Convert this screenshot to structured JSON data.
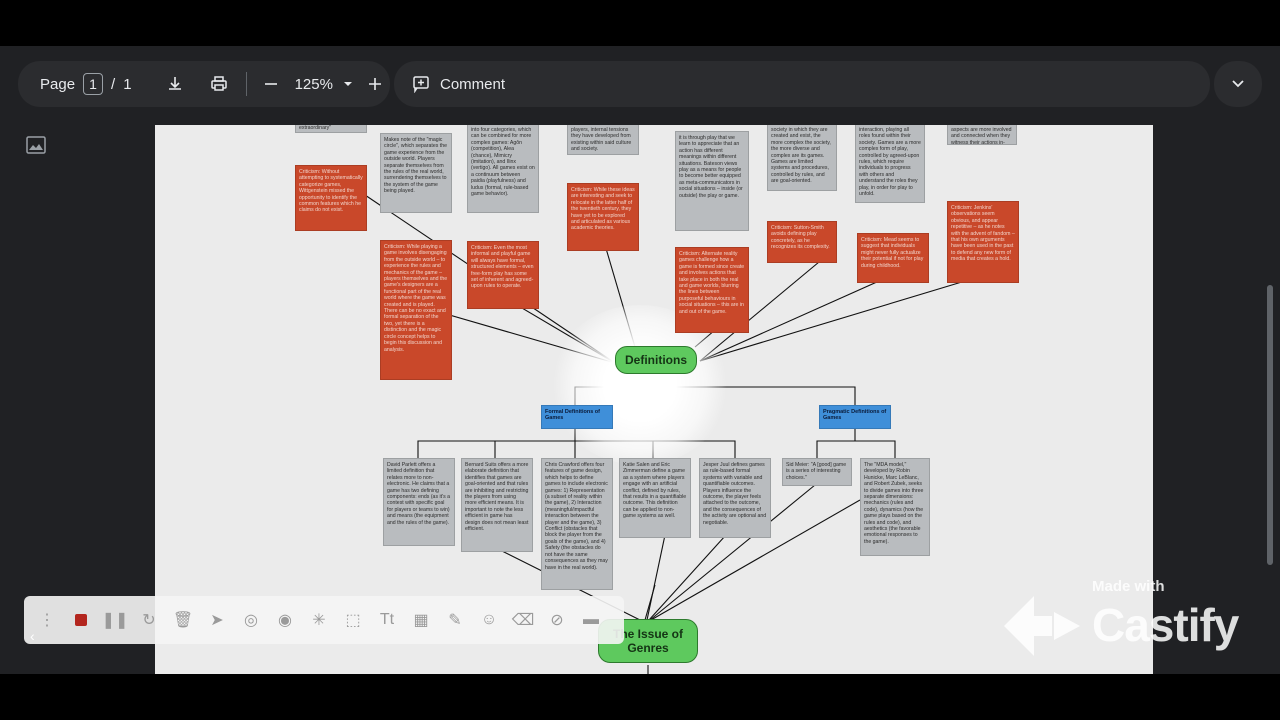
{
  "toolbar": {
    "page_label": "Page",
    "page_current": "1",
    "page_separator": "/",
    "page_total": "1",
    "zoom": "125%",
    "comment_label": "Comment"
  },
  "diagram": {
    "center": "Definitions",
    "genres": "The Issue of Genres",
    "formal": "Formal Definitions of Games",
    "pragmatic": "Pragmatic Definitions of Games",
    "top_gray": [
      "extraordinary\"",
      "Makes note of the \"magic circle\", which separates the game experience from the outside world. Players separate themselves from the rules of the real world, surrendering themselves to the system of the game being played.",
      "into four categories, which can be combined for more complex games: Agôn (competition), Alea (chance), Mimicry (imitation), and Ilinx (vertigo). All games exist on a continuum between paidia (playfulness) and ludus (formal, rule-based game behavior).",
      "players, internal tensions they have developed from existing within said culture and society.",
      "it is through play that we learn to appreciate that an action has different meanings within different situations. Bateson views play as a means for people to become better equipped as meta-communicators in social situations – inside (or outside) the play or game.",
      "society in which they are created and exist, the more complex the society, the more diverse and complex are its games. Games are limited systems and procedures, controlled by rules, and are goal-oriented.",
      "interaction, playing all roles found within their society. Games are a more complex form of play, controlled by agreed-upon rules, which require individuals to progress with others and understand the roles they play, in order for play to unfold.",
      "aspects are more involved and connected when they witness their actions in-game having significant impact, resulting in in-game success"
    ],
    "top_red": [
      "Criticism: Without attempting to systematically categorize games, Wittgenstein missed the opportunity to identify the common features which he claims do not exist.",
      "Criticism: While playing a game involves disengaging from the outside world – to experience the rules and mechanics of the game – players themselves and the game's designers are a functional part of the real world where the game was created and is played. There can be no exact and formal separation of the two, yet there is a distinction and the magic circle concept helps to begin this discussion and analysis.",
      "Criticism: Even the most informal and playful game will always have formal, structured elements – even free-form play has some set of inherent and agreed-upon rules to operate.",
      "Criticism: While these ideas are interesting and seek to relocate in the latter half of the twentieth century, they have yet to be explored and articulated as various academic theories.",
      "Criticism: Alternate reality games challenge how a game is formed since create and involves actions that take place in both the real and game worlds, blurring the lines between purposeful behaviours in social situations – this are in and out of the game.",
      "Criticism: Sutton-Smith avoids defining play concretely, as he recognizes its complexity.",
      "Criticism: Mead seems to suggest that individuals might never fully actualize their potential if not for play during childhood.",
      "Criticism: Jenkins' observations seem obvious, and appear repetitive – as he notes with the advent of fandom – that his own arguments have been used in the past to defend any new form of media that creates a hold."
    ],
    "bottom_gray": [
      "David Parlett offers a limited definition that relates more to non-electronic. He claims that a game has two defining components: ends (as it's a contest with specific goal for players or teams to win) and means (the equipment and the rules of the game).",
      "Bernard Suits offers a more elaborate definition that identifies that games are goal-oriented and that rules are inhibiting and restricting the players from using more efficient means. It is important to note the less efficient in game has design does not mean least efficient.",
      "Chris Crawford offers four features of game design, which helps to define games to include electronic games: 1) Representation (a subset of reality within the game), 2) Interaction (meaningful/impactful interaction between the player and the game), 3) Conflict (obstacles that block the player from the goals of the game), and 4) Safety (the obstacles do not have the same consequences as they may have in the real world).",
      "Katie Salen and Eric Zimmerman define a game as a system where players engage with an artificial conflict, defined by rules, that results in a quantifiable outcome. This definition can be applied to non-game systems as well.",
      "Jesper Juul defines games as rule-based formal systems with variable and quantifiable outcomes. Players influence the outcome, the player feels attached to the outcome, and the consequences of the activity are optional and negotiable.",
      "Sid Meier: \"A [good] game is a series of interesting choices.\"",
      "The \"MDA model,\" developed by Robin Hunicke, Marc LeBlanc, and Robert Zubek, seeks to divide games into three separate dimensions: mechanics (rules and code), dynamics (how the game plays based on the rules and code), and aesthetics (the favorable emotional responses to the game)."
    ]
  },
  "watermark": {
    "made_with": "Made with",
    "brand": "Castify"
  }
}
